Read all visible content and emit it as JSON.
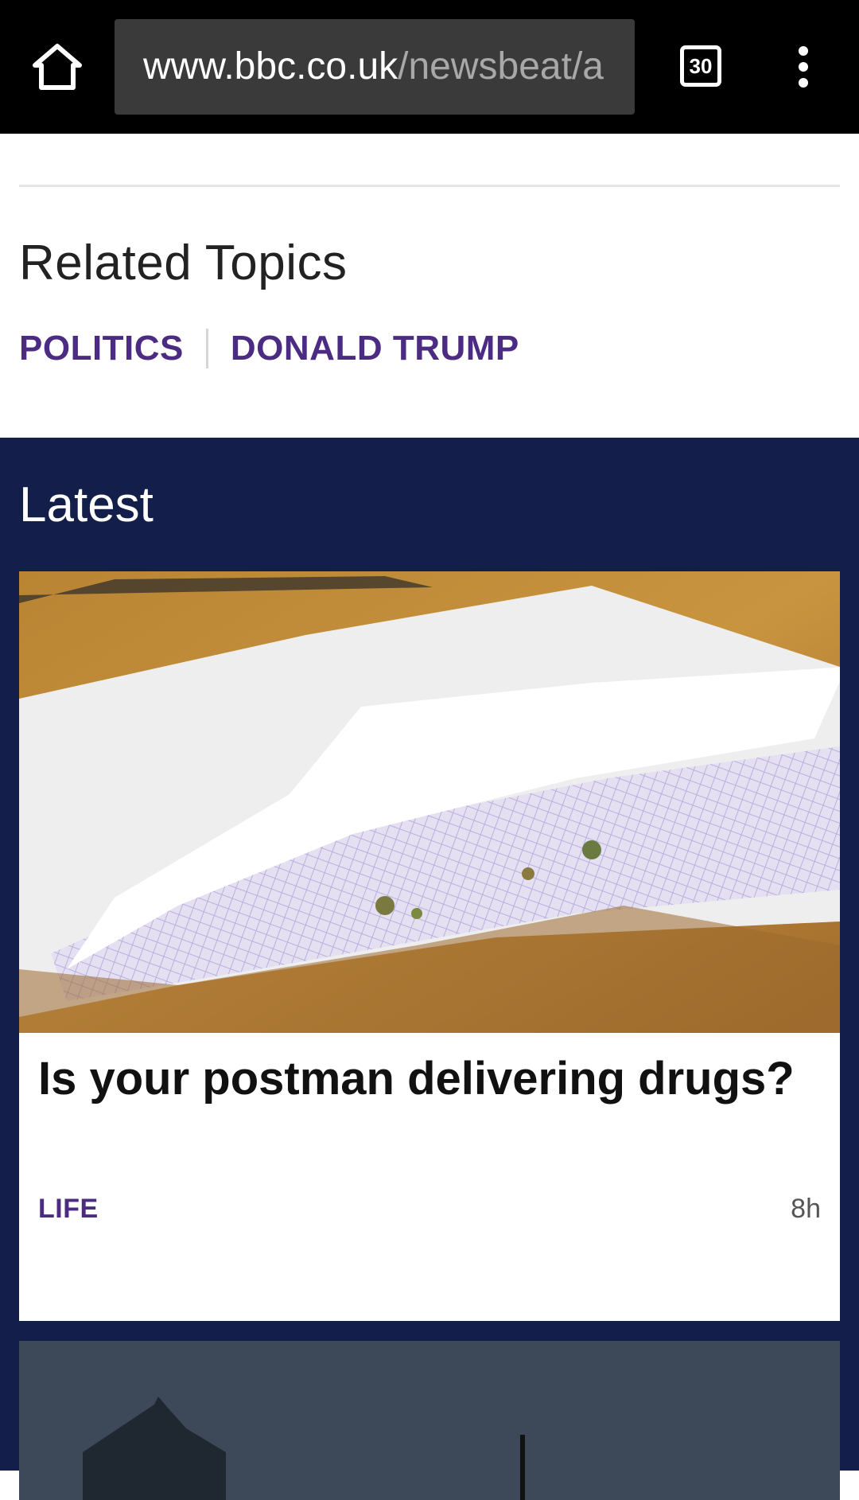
{
  "browser": {
    "url_domain": "www.bbc.co.uk",
    "url_path": "/newsbeat/a",
    "tab_count": "30",
    "icons": {
      "home": "home-icon",
      "menu": "kebab-menu-icon"
    }
  },
  "related": {
    "title": "Related Topics",
    "topics": [
      "POLITICS",
      "DONALD TRUMP"
    ]
  },
  "latest": {
    "title": "Latest",
    "cards": [
      {
        "headline": "Is your postman delivering drugs?",
        "tag": "LIFE",
        "time": "8h",
        "share_icons": [
          "facebook-icon",
          "twitter-icon",
          "share-icon"
        ]
      }
    ]
  },
  "colors": {
    "accent_purple": "#4b2c82",
    "latest_bg": "#141e4a",
    "chrome_bg": "#000000",
    "urlbar_bg": "#3a3a3a"
  }
}
